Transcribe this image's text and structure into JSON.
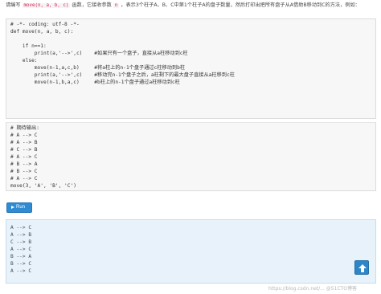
{
  "prompt": {
    "text_before": "请编写 ",
    "func_sig": "move(n, a, b, c)",
    "text_middle": " 函数，它接收参数 ",
    "param": "n",
    "text_after": " ，表示3个柱子A、B、C中第1个柱子A的盘子数量，然后打印出把所有盘子从A借助B移动到C的方法，例如："
  },
  "editor": {
    "lines": [
      "# -*- coding: utf-8 -*-",
      "def move(n, a, b, c):",
      "",
      "    if n==1:",
      "        print(a,'-->',c)    #如果只有一个盘子，直接从a柱移动到c柱",
      "    else:",
      "        move(n-1,a,c,b)     #将a柱上的n-1个盘子通过c柱移动到b柱",
      "        print(a,'-->',c)    #移动完n-1个盘子之后，a柱剩下的最大盘子直接从a柱移到c柱",
      "        move(n-1,b,a,c)     #b柱上的n-1个盘子通过a柱移动到c柱"
    ]
  },
  "expected": {
    "lines": [
      "# 期待输出:",
      "# A --> C",
      "# A --> B",
      "# C --> B",
      "# A --> C",
      "# B --> A",
      "# B --> C",
      "# A --> C",
      "move(3, 'A', 'B', 'C')"
    ]
  },
  "run_button": {
    "label": "Run",
    "icon": "play-icon",
    "color": "#2f8bd2"
  },
  "output": {
    "lines": [
      "A --> C",
      "A --> B",
      "C --> B",
      "A --> C",
      "B --> A",
      "B --> C",
      "A --> C"
    ]
  },
  "back_to_top": {
    "icon": "arrow-up-icon",
    "color": "#2d86c8"
  },
  "watermark": "https://blog.csdn.net/... @51CTO博客"
}
